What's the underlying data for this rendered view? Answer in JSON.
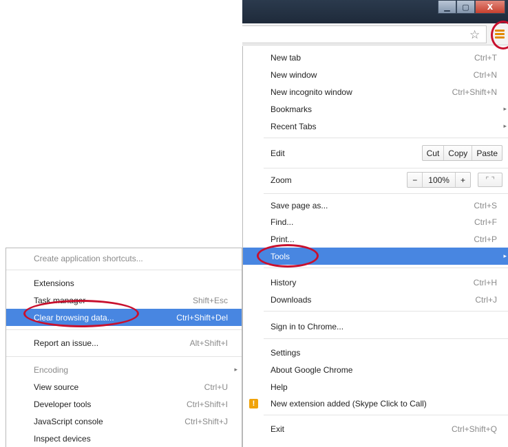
{
  "window": {
    "minimize_glyph": "▁",
    "maximize_glyph": "▢",
    "close_glyph": "X"
  },
  "toolbar": {
    "star_icon": "star-icon",
    "menu_icon": "hamburger-menu-icon",
    "accent_color": "#e28a00"
  },
  "main_menu": {
    "new_tab": {
      "label": "New tab",
      "shortcut": "Ctrl+T"
    },
    "new_window": {
      "label": "New window",
      "shortcut": "Ctrl+N"
    },
    "new_incognito": {
      "label": "New incognito window",
      "shortcut": "Ctrl+Shift+N"
    },
    "bookmarks": {
      "label": "Bookmarks",
      "arrow": "▸"
    },
    "recent_tabs": {
      "label": "Recent Tabs",
      "arrow": "▸"
    },
    "edit": {
      "label": "Edit",
      "cut": "Cut",
      "copy": "Copy",
      "paste": "Paste"
    },
    "zoom": {
      "label": "Zoom",
      "minus": "−",
      "value": "100%",
      "plus": "+",
      "fullscreen_glyph": "⌜ ⌝"
    },
    "save_page": {
      "label": "Save page as...",
      "shortcut": "Ctrl+S"
    },
    "find": {
      "label": "Find...",
      "shortcut": "Ctrl+F"
    },
    "print": {
      "label": "Print...",
      "shortcut": "Ctrl+P"
    },
    "tools": {
      "label": "Tools",
      "arrow": "▸"
    },
    "history": {
      "label": "History",
      "shortcut": "Ctrl+H"
    },
    "downloads": {
      "label": "Downloads",
      "shortcut": "Ctrl+J"
    },
    "sign_in": {
      "label": "Sign in to Chrome..."
    },
    "settings": {
      "label": "Settings"
    },
    "about": {
      "label": "About Google Chrome"
    },
    "help": {
      "label": "Help"
    },
    "extension_notice": {
      "label": "New extension added (Skype Click to Call)",
      "icon": "!"
    },
    "exit": {
      "label": "Exit",
      "shortcut": "Ctrl+Shift+Q"
    },
    "highlight_color": "#4886e1"
  },
  "tools_submenu": {
    "create_shortcuts": {
      "label": "Create application shortcuts..."
    },
    "extensions": {
      "label": "Extensions"
    },
    "task_manager": {
      "label": "Task manager",
      "shortcut": "Shift+Esc"
    },
    "clear_browsing": {
      "label": "Clear browsing data...",
      "shortcut": "Ctrl+Shift+Del"
    },
    "report_issue": {
      "label": "Report an issue...",
      "shortcut": "Alt+Shift+I"
    },
    "encoding": {
      "label": "Encoding",
      "arrow": "▸"
    },
    "view_source": {
      "label": "View source",
      "shortcut": "Ctrl+U"
    },
    "developer_tools": {
      "label": "Developer tools",
      "shortcut": "Ctrl+Shift+I"
    },
    "js_console": {
      "label": "JavaScript console",
      "shortcut": "Ctrl+Shift+J"
    },
    "inspect_devices": {
      "label": "Inspect devices"
    }
  },
  "annotation_color": "#c8102e"
}
